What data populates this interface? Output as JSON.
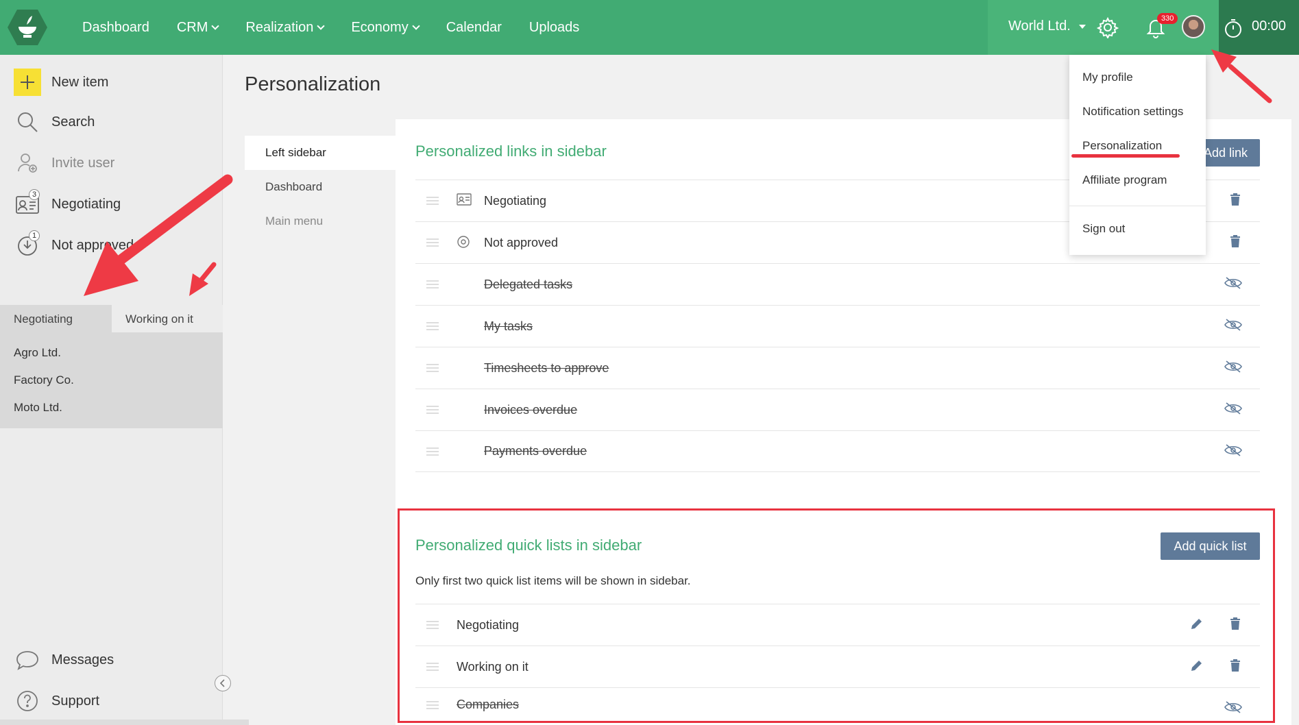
{
  "nav": {
    "items": [
      {
        "label": "Dashboard",
        "dropdown": false
      },
      {
        "label": "CRM",
        "dropdown": true
      },
      {
        "label": "Realization",
        "dropdown": true
      },
      {
        "label": "Economy",
        "dropdown": true
      },
      {
        "label": "Calendar",
        "dropdown": false
      },
      {
        "label": "Uploads",
        "dropdown": false
      }
    ],
    "company": "World Ltd.",
    "notification_count": "330",
    "timer": "00:00"
  },
  "sidebar": {
    "items": [
      {
        "label": "New item"
      },
      {
        "label": "Search"
      },
      {
        "label": "Invite user"
      },
      {
        "label": "Negotiating",
        "badge": "3"
      },
      {
        "label": "Not approved",
        "badge": "1"
      }
    ],
    "quicklist_tabs": [
      "Negotiating",
      "Working on it"
    ],
    "quicklist_items": [
      "Agro Ltd.",
      "Factory Co.",
      "Moto Ltd."
    ],
    "bottom": [
      {
        "label": "Messages"
      },
      {
        "label": "Support"
      }
    ]
  },
  "page": {
    "title": "Personalization",
    "subnav": [
      "Left sidebar",
      "Dashboard",
      "Main menu"
    ]
  },
  "links_section": {
    "title": "Personalized links in sidebar",
    "add_label": "Add link",
    "rows": [
      {
        "label": "Negotiating",
        "hidden": false,
        "icon": "contact-card-icon"
      },
      {
        "label": "Not approved",
        "hidden": false,
        "icon": "approval-stamp-icon"
      },
      {
        "label": "Delegated tasks",
        "hidden": true
      },
      {
        "label": "My tasks",
        "hidden": true
      },
      {
        "label": "Timesheets to approve",
        "hidden": true
      },
      {
        "label": "Invoices overdue",
        "hidden": true
      },
      {
        "label": "Payments overdue",
        "hidden": true
      }
    ]
  },
  "quicklists_section": {
    "title": "Personalized quick lists in sidebar",
    "add_label": "Add quick list",
    "note": "Only first two quick list items will be shown in sidebar.",
    "rows": [
      {
        "label": "Negotiating",
        "hidden": false
      },
      {
        "label": "Working on it",
        "hidden": false
      },
      {
        "label": "Companies",
        "hidden": true
      }
    ]
  },
  "profile_menu": {
    "items": [
      "My profile",
      "Notification settings",
      "Personalization",
      "Affiliate program",
      "Sign out"
    ]
  },
  "colors": {
    "brand_green": "#41ab73",
    "button_blue": "#5f7a99",
    "annotation_red": "#e8323f",
    "new_item_yellow": "#f7e034"
  }
}
